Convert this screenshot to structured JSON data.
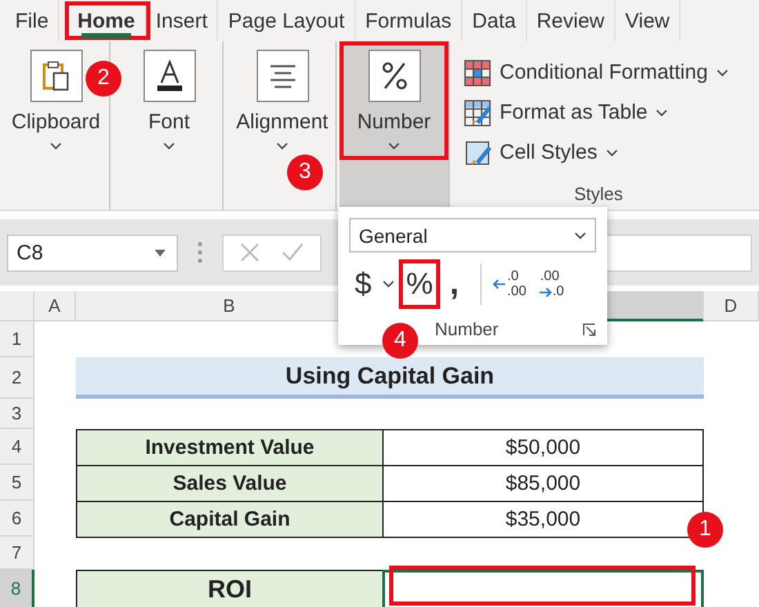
{
  "tabs": [
    {
      "label": "File",
      "selected": false,
      "highlighted": false
    },
    {
      "label": "Home",
      "selected": true,
      "highlighted": true
    },
    {
      "label": "Insert",
      "selected": false,
      "highlighted": false
    },
    {
      "label": "Page Layout",
      "selected": false,
      "highlighted": false
    },
    {
      "label": "Formulas",
      "selected": false,
      "highlighted": false
    },
    {
      "label": "Data",
      "selected": false,
      "highlighted": false
    },
    {
      "label": "Review",
      "selected": false,
      "highlighted": false
    },
    {
      "label": "View",
      "selected": false,
      "highlighted": false
    }
  ],
  "ribbon": {
    "groups": [
      {
        "kind": "clipboard",
        "label": "Clipboard",
        "selected": false,
        "highlighted": false
      },
      {
        "kind": "font",
        "label": "Font",
        "selected": false,
        "highlighted": false
      },
      {
        "kind": "alignment",
        "label": "Alignment",
        "selected": false,
        "highlighted": false
      },
      {
        "kind": "number",
        "label": "Number",
        "selected": true,
        "highlighted": true
      }
    ],
    "styles": {
      "label": "Styles",
      "items": [
        {
          "kind": "conditional",
          "label": "Conditional Formatting"
        },
        {
          "kind": "table",
          "label": "Format as Table"
        },
        {
          "kind": "cell",
          "label": "Cell Styles"
        }
      ]
    }
  },
  "name_box": "C8",
  "number_popup": {
    "format": "General",
    "label": "Number",
    "buttons": [
      {
        "kind": "currency",
        "symbol": "$",
        "highlighted": false
      },
      {
        "kind": "percent",
        "symbol": "%",
        "highlighted": true
      },
      {
        "kind": "comma",
        "symbol": ",",
        "highlighted": false
      },
      {
        "kind": "increase-decimal",
        "top": ".0",
        "bottom": ".00",
        "highlighted": false
      },
      {
        "kind": "decrease-decimal",
        "top": ".00",
        "bottom": ".0",
        "highlighted": false
      }
    ]
  },
  "sheet": {
    "columns": [
      {
        "label": "A",
        "selected": false
      },
      {
        "label": "B",
        "selected": false
      },
      {
        "selected": true
      },
      {
        "label": "D",
        "selected": false
      }
    ],
    "rows": [
      {
        "label": "1",
        "selected": false
      },
      {
        "label": "2",
        "selected": false
      },
      {
        "label": "3",
        "selected": false
      },
      {
        "label": "4",
        "selected": false
      },
      {
        "label": "5",
        "selected": false
      },
      {
        "label": "6",
        "selected": false
      },
      {
        "label": "7",
        "selected": false
      },
      {
        "label": "8",
        "selected": true
      }
    ],
    "title": "Using Capital Gain",
    "table": [
      {
        "label": "Investment Value",
        "value": "$50,000"
      },
      {
        "label": "Sales Value",
        "value": "$85,000"
      },
      {
        "label": "Capital Gain",
        "value": "$35,000"
      }
    ],
    "result": {
      "label": "ROI",
      "selected": true,
      "highlighted": true
    }
  },
  "badges": [
    {
      "number": "1"
    },
    {
      "number": "2"
    },
    {
      "number": "3"
    },
    {
      "number": "4"
    }
  ]
}
